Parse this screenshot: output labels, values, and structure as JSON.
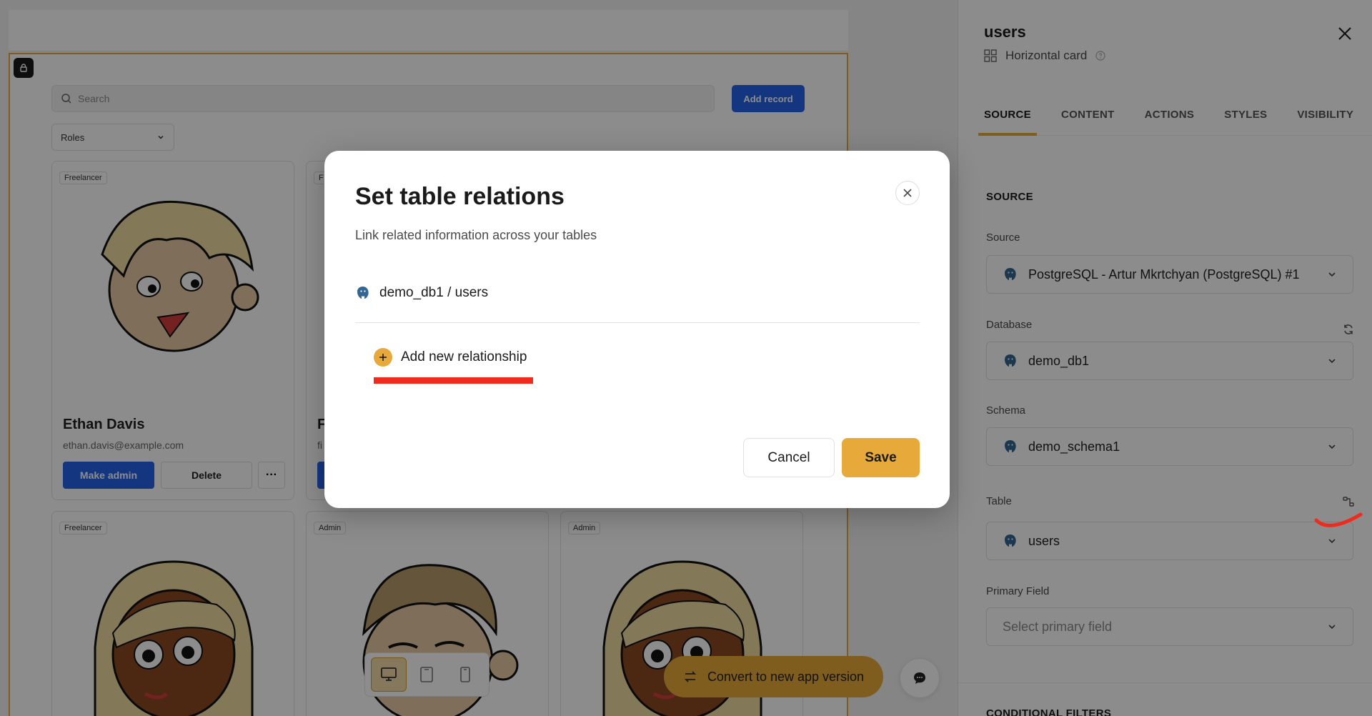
{
  "canvas": {
    "search_placeholder": "Search",
    "add_record_label": "Add record",
    "roles_filter_label": "Roles",
    "cards": [
      {
        "role": "Freelancer",
        "name": "Ethan Davis",
        "email": "ethan.davis@example.com",
        "make_admin_label": "Make admin",
        "delete_label": "Delete",
        "more_label": "···"
      },
      {
        "role": "F",
        "name": "F",
        "email": "fi",
        "make_admin_label": "",
        "delete_label": "",
        "more_label": ""
      },
      {
        "role": "Freelancer",
        "name": "",
        "email": "",
        "make_admin_label": "",
        "delete_label": "",
        "more_label": ""
      },
      {
        "role": "Admin",
        "name": "",
        "email": "",
        "make_admin_label": "",
        "delete_label": "",
        "more_label": ""
      },
      {
        "role": "Admin",
        "name": "",
        "email": "",
        "make_admin_label": "",
        "delete_label": "",
        "more_label": ""
      }
    ],
    "device_modes": [
      "desktop-icon",
      "tablet-icon",
      "mobile-icon"
    ],
    "active_device": "desktop",
    "convert_label": "Convert to new app version"
  },
  "panel": {
    "title": "users",
    "subtitle": "Horizontal card",
    "tabs": [
      {
        "label": "SOURCE",
        "active": true
      },
      {
        "label": "CONTENT",
        "active": false
      },
      {
        "label": "ACTIONS",
        "active": false
      },
      {
        "label": "STYLES",
        "active": false
      },
      {
        "label": "VISIBILITY",
        "active": false
      }
    ],
    "section_title": "SOURCE",
    "fields": {
      "source": {
        "label": "Source",
        "value": "PostgreSQL - Artur Mkrtchyan (PostgreSQL) #1"
      },
      "database": {
        "label": "Database",
        "value": "demo_db1"
      },
      "schema": {
        "label": "Schema",
        "value": "demo_schema1"
      },
      "table": {
        "label": "Table",
        "value": "users"
      },
      "primary_field": {
        "label": "Primary Field",
        "placeholder": "Select primary field"
      }
    },
    "conditional_filters_title": "CONDITIONAL FILTERS"
  },
  "modal": {
    "title": "Set table relations",
    "subtitle": "Link related information across your tables",
    "table_path": "demo_db1 / users",
    "add_relationship_label": "Add new relationship",
    "cancel_label": "Cancel",
    "save_label": "Save"
  },
  "colors": {
    "accent": "#e6a93a",
    "primary_blue": "#2563eb",
    "annotation_red": "#ee2b1c",
    "overlay": "rgba(0,0,0,0.45)"
  }
}
